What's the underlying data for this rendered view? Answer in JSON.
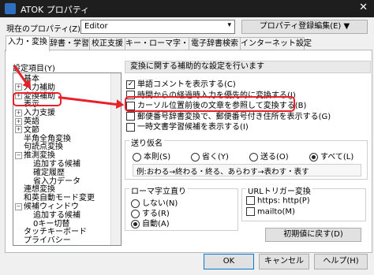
{
  "window": {
    "title": "ATOK プロパティ",
    "close": "✕"
  },
  "profile": {
    "label": "現在のプロパティ(Z)",
    "value": "Editor",
    "register_button": "プロパティ登録編集(E) ▼"
  },
  "tabs": [
    "入力・変換",
    "辞書・学習",
    "校正支援",
    "キー・ローマ字・色",
    "電子辞書検索",
    "インターネット設定"
  ],
  "tree": {
    "label": "設定項目(Y)",
    "items": [
      {
        "text": "基本",
        "indent": 1,
        "toggle": ""
      },
      {
        "text": "入力補助",
        "indent": 1,
        "toggle": "+"
      },
      {
        "text": "変換補助",
        "indent": 1,
        "toggle": "+"
      },
      {
        "text": "表示",
        "indent": 1,
        "toggle": ""
      },
      {
        "text": "入力支援",
        "indent": 1,
        "toggle": "+"
      },
      {
        "text": "英語",
        "indent": 1,
        "toggle": "+"
      },
      {
        "text": "文節",
        "indent": 1,
        "toggle": "+"
      },
      {
        "text": "半角全角変換",
        "indent": 1,
        "toggle": ""
      },
      {
        "text": "句読点変換",
        "indent": 1,
        "toggle": ""
      },
      {
        "text": "推測変換",
        "indent": 1,
        "toggle": "−"
      },
      {
        "text": "追加する候補",
        "indent": 2,
        "toggle": ""
      },
      {
        "text": "確定履歴",
        "indent": 2,
        "toggle": ""
      },
      {
        "text": "省入力データ",
        "indent": 2,
        "toggle": ""
      },
      {
        "text": "連想変換",
        "indent": 1,
        "toggle": ""
      },
      {
        "text": "和英自動モード変更",
        "indent": 1,
        "toggle": ""
      },
      {
        "text": "候補ウィンドウ",
        "indent": 1,
        "toggle": "−"
      },
      {
        "text": "追加する候補",
        "indent": 2,
        "toggle": ""
      },
      {
        "text": "0キー切替",
        "indent": 2,
        "toggle": ""
      },
      {
        "text": "タッチキーボード",
        "indent": 1,
        "toggle": ""
      },
      {
        "text": "プライバシー",
        "indent": 1,
        "toggle": ""
      }
    ]
  },
  "section_header": "変換に関する補助的な設定を行います",
  "options": [
    {
      "label": "単語コメントを表示する(C)",
      "checked": true
    },
    {
      "label": "時間からの経過時入力を優先的に変換する(J)",
      "checked": false
    },
    {
      "label": "カーソル位置前後の文章を参照して変換する(B)",
      "checked": false
    },
    {
      "label": "郵便番号辞書変換で、郵便番号付き住所を表示する(G)",
      "checked": false
    },
    {
      "label": "一時文書学習候補を表示する(I)",
      "checked": false
    }
  ],
  "okurigana": {
    "title": "送り仮名",
    "options": [
      {
        "label": "本則(S)",
        "selected": false
      },
      {
        "label": "省く(Y)",
        "selected": false
      },
      {
        "label": "送る(O)",
        "selected": false
      },
      {
        "label": "すべて(L)",
        "selected": true
      }
    ],
    "example": "例:おわる→終わる・終る、あらわす→表わす・表す"
  },
  "romaji": {
    "title": "ローマ字立直り",
    "options": [
      {
        "label": "しない(N)",
        "selected": false
      },
      {
        "label": "する(R)",
        "selected": false
      },
      {
        "label": "自動(A)",
        "selected": true
      }
    ]
  },
  "url_trigger": {
    "title": "URLトリガー変換",
    "options": [
      {
        "label": "https: http(P)",
        "checked": false
      },
      {
        "label": "mailto(M)",
        "checked": false
      }
    ]
  },
  "buttons": {
    "reset": "初期値に戻す(D)",
    "ok": "OK",
    "cancel": "キャンセル",
    "help": "ヘルプ(H)"
  },
  "colors": {
    "annotation": "#e8202a",
    "titlebar": "#1e1e1e"
  }
}
